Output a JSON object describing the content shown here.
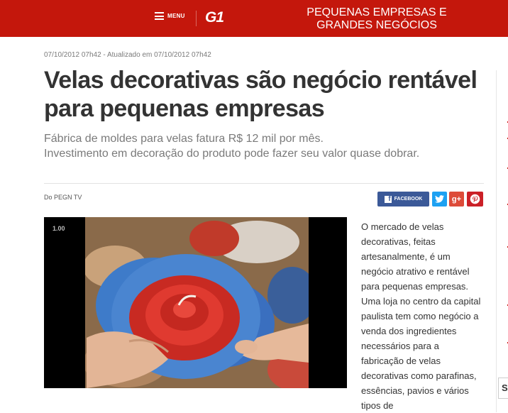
{
  "header": {
    "menu_label": "MENU",
    "logo_text": "G1",
    "section_title_line1": "PEQUENAS EMPRESAS E",
    "section_title_line2": "GRANDES NEGÓCIOS",
    "brand_color": "#c4170c"
  },
  "article": {
    "meta": "07/10/2012 07h42 - Atualizado em 07/10/2012 07h42",
    "title": "Velas decorativas são negócio rentável para pequenas empresas",
    "subtitle_line1": "Fábrica de moldes para velas fatura R$ 12 mil por mês.",
    "subtitle_line2": "Investimento em decoração do produto pode fazer seu valor quase dobrar.",
    "byline": "Do PEGN TV",
    "body": "O mercado de velas decorativas, feitas artesanalmente, é um negócio atrativo e rentável para pequenas empresas. Uma loja no centro da capital paulista tem como negócio a venda dos ingredientes necessários para a fabricação de velas decorativas como parafinas, essências, pavios e vários tipos de"
  },
  "share": {
    "facebook_label": "FACEBOOK",
    "twitter_icon": "twitter-bird-icon",
    "googleplus_label": "g+",
    "pinterest_icon": "pinterest-p-icon"
  },
  "video": {
    "speed_label": "1.00"
  },
  "sidebar": {
    "partial_letter": "S"
  }
}
